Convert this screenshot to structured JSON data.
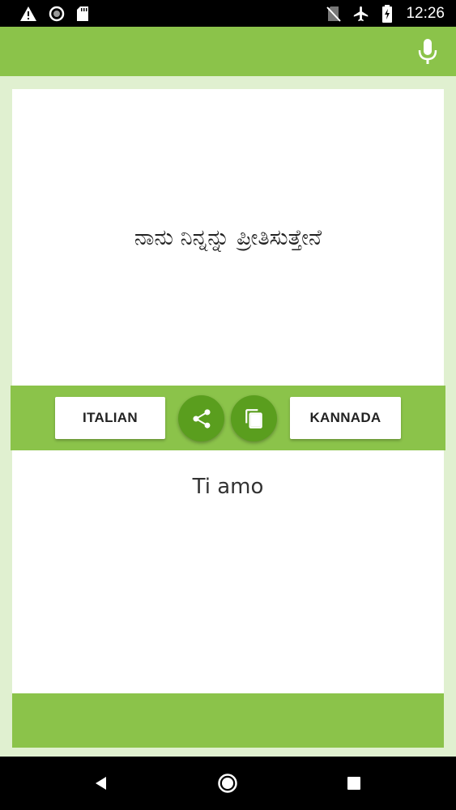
{
  "status_bar": {
    "time": "12:26",
    "icons_left": [
      "warning-icon",
      "circle-icon",
      "sd-card-icon"
    ],
    "icons_right": [
      "no-sim-icon",
      "airplane-icon",
      "battery-charging-icon"
    ]
  },
  "app_bar": {
    "mic_icon": "microphone-icon"
  },
  "source": {
    "text": "ನಾನು ನಿನ್ನನ್ನು ಪ್ರೀತಿಸುತ್ತೇನೆ"
  },
  "controls": {
    "left_language": "ITALIAN",
    "right_language": "KANNADA",
    "share_icon": "share-icon",
    "copy_icon": "copy-icon"
  },
  "target": {
    "text": "Ti amo"
  },
  "colors": {
    "primary": "#8bc34a",
    "accent": "#5a9e1e",
    "background": "#e0f0d0"
  }
}
